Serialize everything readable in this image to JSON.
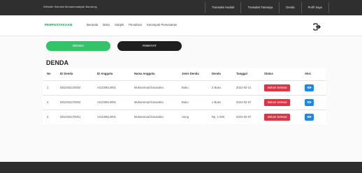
{
  "topbar": {
    "site_text": "Website Sekolah Muhammadiyah Bandung",
    "links": [
      "Transaksi Hadiah",
      "Transaksi Tamasya",
      "Denda",
      "Profil Saya"
    ]
  },
  "navbar": {
    "brand": "PERPUSTAKAAN",
    "menu": [
      "Beranda",
      "Buku",
      "Subjek",
      "Penulisan",
      "Kelompok Pemesanan"
    ]
  },
  "tabs": {
    "denda": "DENDA",
    "riwayat": "RIWAYAT"
  },
  "page_title": "DENDA",
  "table": {
    "headers": [
      "No",
      "ID Denda",
      "ID Anggota",
      "Nama Anggota",
      "Jenis Denda",
      "Denda",
      "Tanggal",
      "Status",
      "Aksi"
    ],
    "rows": [
      {
        "no": "1",
        "id_denda": "DD2402210002",
        "id_anggota": "AG230614001",
        "nama": "Muhammad Ibnusatria",
        "jenis": "Buku",
        "denda": "2 Buku",
        "tanggal": "2024-02-21",
        "status": "Belum Selesai"
      },
      {
        "no": "2",
        "id_denda": "DD2402270002",
        "id_anggota": "AG230614001",
        "nama": "Muhammad Ibnusatria",
        "jenis": "Buku",
        "denda": "1 Buku",
        "tanggal": "2024-02-07",
        "status": "Belum Selesai"
      },
      {
        "no": "3",
        "id_denda": "DD2402270001",
        "id_anggota": "AG230614001",
        "nama": "Muhammad Ibnusatria",
        "jenis": "Uang",
        "denda": "Rp. 1.000",
        "tanggal": "2024-02-07",
        "status": "Belum Selesai"
      }
    ]
  },
  "colors": {
    "accent_green": "#33c46a",
    "brand_green": "#1b9a4a",
    "status_red": "#dc3545",
    "action_blue": "#1e88e5",
    "dark": "#2f2f2f"
  },
  "icons": {
    "logout": "logout-icon",
    "view": "eye-icon"
  }
}
